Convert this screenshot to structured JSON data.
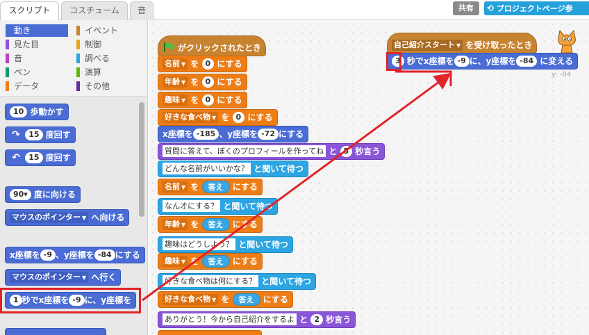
{
  "tabs": [
    "スクリプト",
    "コスチューム",
    "音"
  ],
  "header": {
    "share": "共有",
    "project_page": "プロジェクトページ参"
  },
  "categories": [
    {
      "label": "動き",
      "color": "#4a6cd4"
    },
    {
      "label": "イベント",
      "color": "#c88330"
    },
    {
      "label": "見た目",
      "color": "#8a55d7"
    },
    {
      "label": "制御",
      "color": "#e1a91a"
    },
    {
      "label": "音",
      "color": "#bb42c3"
    },
    {
      "label": "調べる",
      "color": "#2ca5e2"
    },
    {
      "label": "ペン",
      "color": "#0e9a6c"
    },
    {
      "label": "演算",
      "color": "#5cb712"
    },
    {
      "label": "データ",
      "color": "#ee7d16"
    },
    {
      "label": "その他",
      "color": "#632d99"
    }
  ],
  "palette": {
    "move": {
      "v": "10",
      "t": "歩動かす"
    },
    "turn_right": {
      "v": "15",
      "t": "度回す"
    },
    "turn_left": {
      "v": "15",
      "t": "度回す"
    },
    "point_dir": {
      "v": "90▾",
      "t": "度に向ける"
    },
    "point_towards": {
      "d": "マウスのポインター",
      "t": "へ向ける"
    },
    "goto_xy": {
      "a": "x座標を",
      "x": "-9",
      "b": "、y座標を",
      "y": "-84",
      "c": "にする"
    },
    "goto": {
      "d": "マウスのポインター",
      "t": "へ行く"
    },
    "glide": {
      "s": "1",
      "a": "秒でx座標を",
      "x": "-9",
      "b": "に、y座標を"
    }
  },
  "script1": {
    "hat": "がクリックされたとき",
    "set_name": {
      "var": "名前",
      "mid": "を",
      "val": "0",
      "end": "にする"
    },
    "set_age": {
      "var": "年齢",
      "mid": "を",
      "val": "0",
      "end": "にする"
    },
    "set_hobby": {
      "var": "趣味",
      "mid": "を",
      "val": "0",
      "end": "にする"
    },
    "set_food": {
      "var": "好きな食べ物",
      "mid": "を",
      "val": "0",
      "end": "にする"
    },
    "goto": {
      "a": "x座標を",
      "x": "-185",
      "b": "、y座標を",
      "y": "-72",
      "c": "にする"
    },
    "say1": {
      "msg": "質問に答えて、ぼくのプロフィールを作ってね",
      "mid": "と",
      "sec": "5",
      "end": "秒言う"
    },
    "ask1": {
      "q": "どんな名前がいいかな？",
      "end": "と聞いて待つ"
    },
    "set_name_ans": {
      "var": "名前",
      "mid": "を",
      "ans": "答え",
      "end": "にする"
    },
    "ask2": {
      "q": "なん才にする？",
      "end": "と聞いて待つ"
    },
    "set_age_ans": {
      "var": "年齢",
      "mid": "を",
      "ans": "答え",
      "end": "にする"
    },
    "ask3": {
      "q": "趣味はどうしよう？",
      "end": "と聞いて待つ"
    },
    "set_hobby_ans": {
      "var": "趣味",
      "mid": "を",
      "ans": "答え",
      "end": "にする"
    },
    "ask4": {
      "q": "好きな食べ物は何にする？",
      "end": "と聞いて待つ"
    },
    "set_food_ans": {
      "var": "好きな食べ物",
      "mid": "を",
      "ans": "答え",
      "end": "にする"
    },
    "say2": {
      "msg": "ありがとう！今から自己紹介をするよ",
      "mid": "と",
      "sec": "2",
      "end": "秒言う"
    }
  },
  "script2": {
    "hat": {
      "msg": "自己紹介スタート",
      "end": "を受け取ったとき"
    },
    "glide": {
      "s": "3",
      "a": "秒でx座標を",
      "x": "-9",
      "b": "に、y座標を",
      "y": "-84",
      "c": "に変える"
    }
  },
  "coord": "y: -84"
}
